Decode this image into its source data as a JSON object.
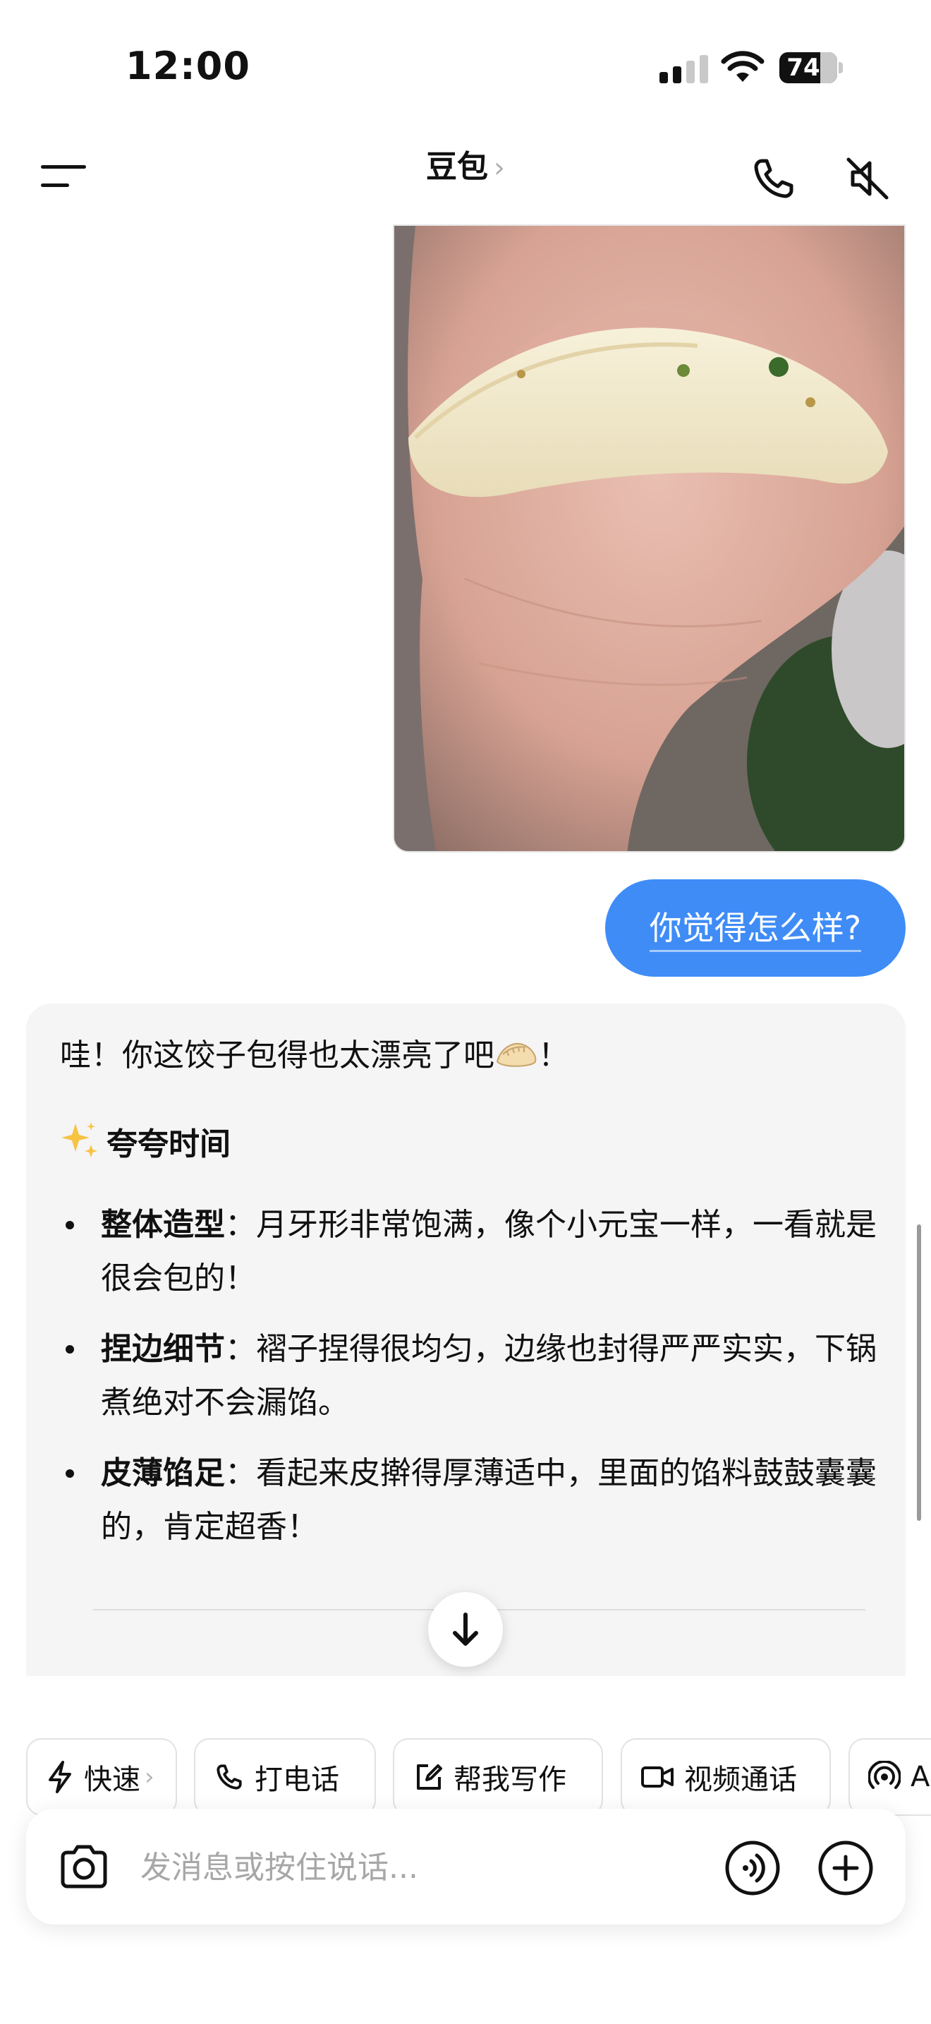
{
  "status_bar": {
    "time": "12:00",
    "battery_level": "74",
    "signal_icon": "cellular-signal-icon",
    "wifi_icon": "wifi-icon"
  },
  "header": {
    "title": "豆包",
    "title_chevron": "›",
    "menu_icon": "menu-icon",
    "call_icon": "phone-icon",
    "mute_icon": "speaker-muted-icon"
  },
  "messages": {
    "user_image": "dumpling-photo",
    "user_text": "你觉得怎么样?",
    "ai": {
      "intro_before": "哇！你这饺子包得也太漂亮了吧",
      "intro_after": "！",
      "intro_emoji": "dumpling-emoji",
      "heading_emoji": "sparkles-emoji",
      "heading": "夸夸时间",
      "bullets": [
        {
          "title": "整体造型",
          "text": "：月牙形非常饱满，像个小元宝一样，一看就是很会包的！"
        },
        {
          "title": "捏边细节",
          "text": "：褶子捏得很均匀，边缘也封得严严实实，下锅煮绝对不会漏馅。"
        },
        {
          "title": "皮薄馅足",
          "text": "：看起来皮擀得厚薄适中，里面的馅料鼓鼓囊囊的，肯定超香！"
        }
      ]
    }
  },
  "quick_actions": [
    {
      "label": "快速",
      "icon": "lightning-icon",
      "chevron": "›"
    },
    {
      "label": "打电话",
      "icon": "phone-icon"
    },
    {
      "label": "帮我写作",
      "icon": "edit-icon"
    },
    {
      "label": "视频通话",
      "icon": "video-icon"
    },
    {
      "label": "A",
      "icon": "broadcast-icon"
    }
  ],
  "composer": {
    "placeholder": "发消息或按住说话...",
    "camera_icon": "camera-icon",
    "voice_icon": "voice-icon",
    "plus_icon": "plus-icon"
  },
  "colors": {
    "accent": "#3f8cf7",
    "ai_bubble_bg": "#f5f5f6"
  }
}
